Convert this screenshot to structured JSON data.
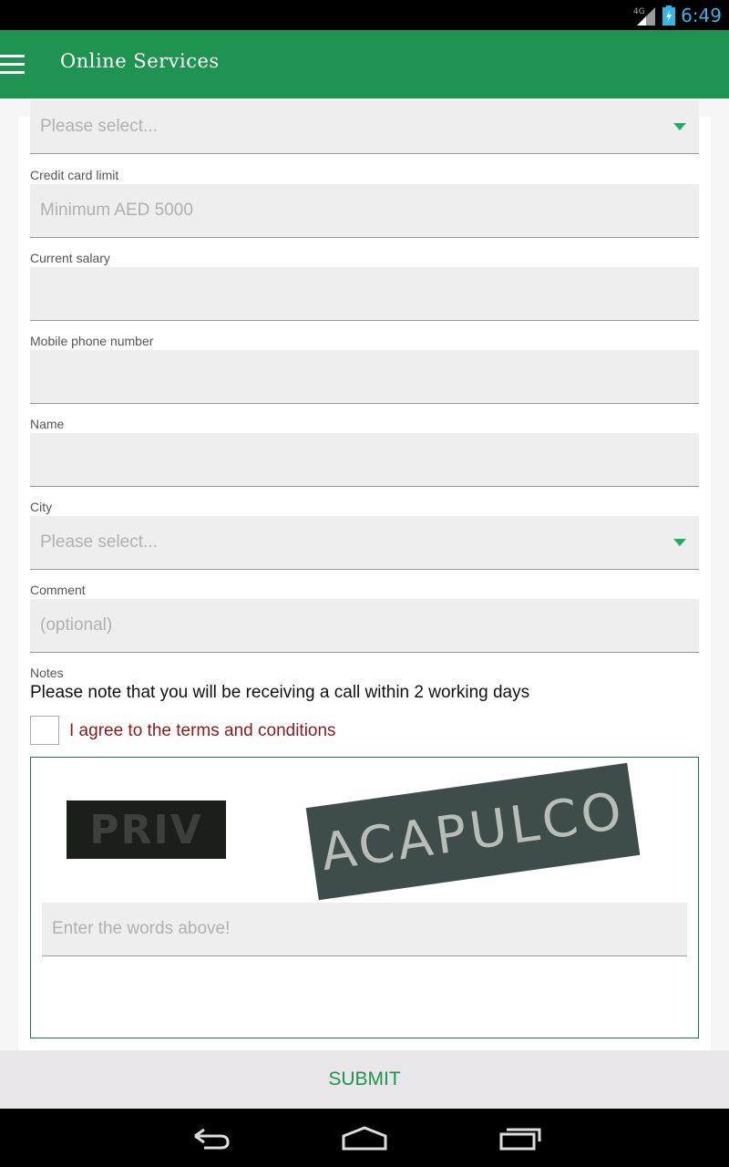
{
  "status_bar": {
    "network": "4G",
    "time": "6:49"
  },
  "app_bar": {
    "title": "Online Services"
  },
  "form": {
    "top_select": {
      "placeholder": "Please select..."
    },
    "credit_limit": {
      "label": "Credit card limit",
      "placeholder": "Minimum AED 5000"
    },
    "salary": {
      "label": "Current salary",
      "placeholder": ""
    },
    "mobile": {
      "label": "Mobile phone number",
      "placeholder": ""
    },
    "name": {
      "label": "Name",
      "placeholder": ""
    },
    "city": {
      "label": "City",
      "placeholder": "Please select..."
    },
    "comment": {
      "label": "Comment",
      "placeholder": "(optional)"
    },
    "notes": {
      "label": "Notes",
      "text": "Please note that you will be receiving a call within 2 working days"
    },
    "terms": {
      "label": "I agree to the terms and conditions",
      "checked": false
    },
    "captcha": {
      "word1": "PRIV",
      "word2": "ACAPULCO",
      "placeholder": "Enter the words above!"
    }
  },
  "submit_label": "SUBMIT",
  "colors": {
    "primary": "#1e9450",
    "accent_arrow": "#1ab163",
    "terms_text": "#8b1a1a",
    "status_blue": "#33b5e5"
  },
  "nav_icons": [
    "back-icon",
    "home-icon",
    "recent-apps-icon"
  ]
}
